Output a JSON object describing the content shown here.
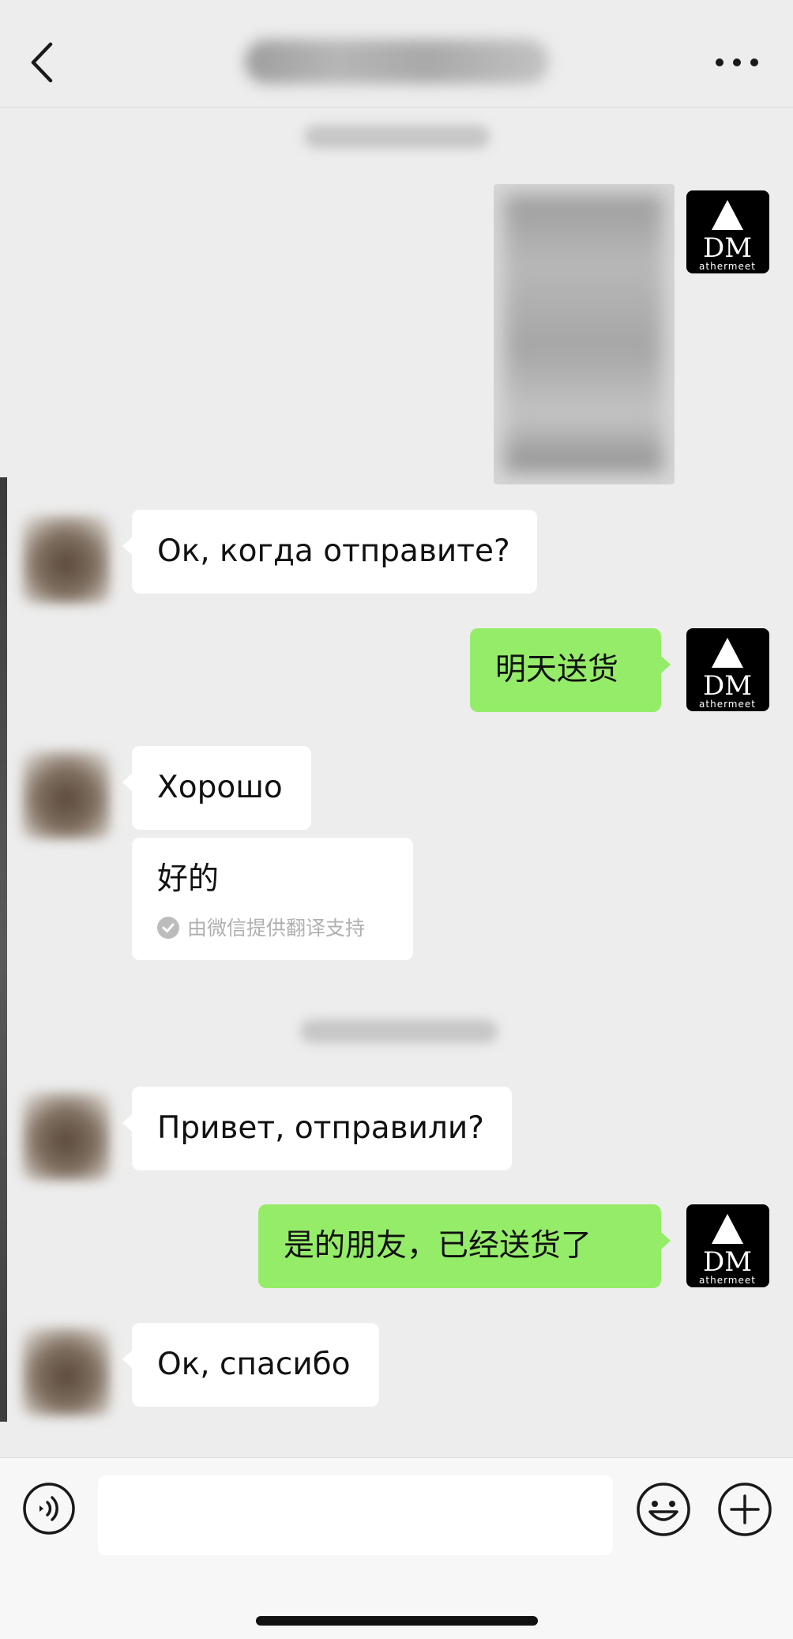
{
  "header": {
    "back_icon": "chevron-left-icon",
    "more_icon": "ellipsis-icon"
  },
  "brand": {
    "logo_text_top": "DM",
    "logo_text_bottom": "athermeet",
    "bubble_out_color": "#95ec69",
    "bubble_in_color": "#ffffff",
    "background_color": "#ededed"
  },
  "messages": [
    {
      "id": "m1",
      "side": "out",
      "kind": "image"
    },
    {
      "id": "m2",
      "side": "in",
      "text": "Ок, когда отправите?"
    },
    {
      "id": "m3",
      "side": "out",
      "text": "明天送货"
    },
    {
      "id": "m4",
      "side": "in",
      "text": "Хорошо"
    },
    {
      "id": "m5",
      "side": "in",
      "text": "好的",
      "translation_note": "由微信提供翻译支持"
    },
    {
      "id": "m6",
      "side": "in",
      "text": "Привет, отправили?"
    },
    {
      "id": "m7",
      "side": "out",
      "text": "是的朋友，已经送货了"
    },
    {
      "id": "m8",
      "side": "in",
      "text": "Ок, спасибо"
    }
  ],
  "input_bar": {
    "voice_icon": "voice-icon",
    "emoji_icon": "emoji-icon",
    "plus_icon": "plus-icon",
    "message_value": ""
  }
}
